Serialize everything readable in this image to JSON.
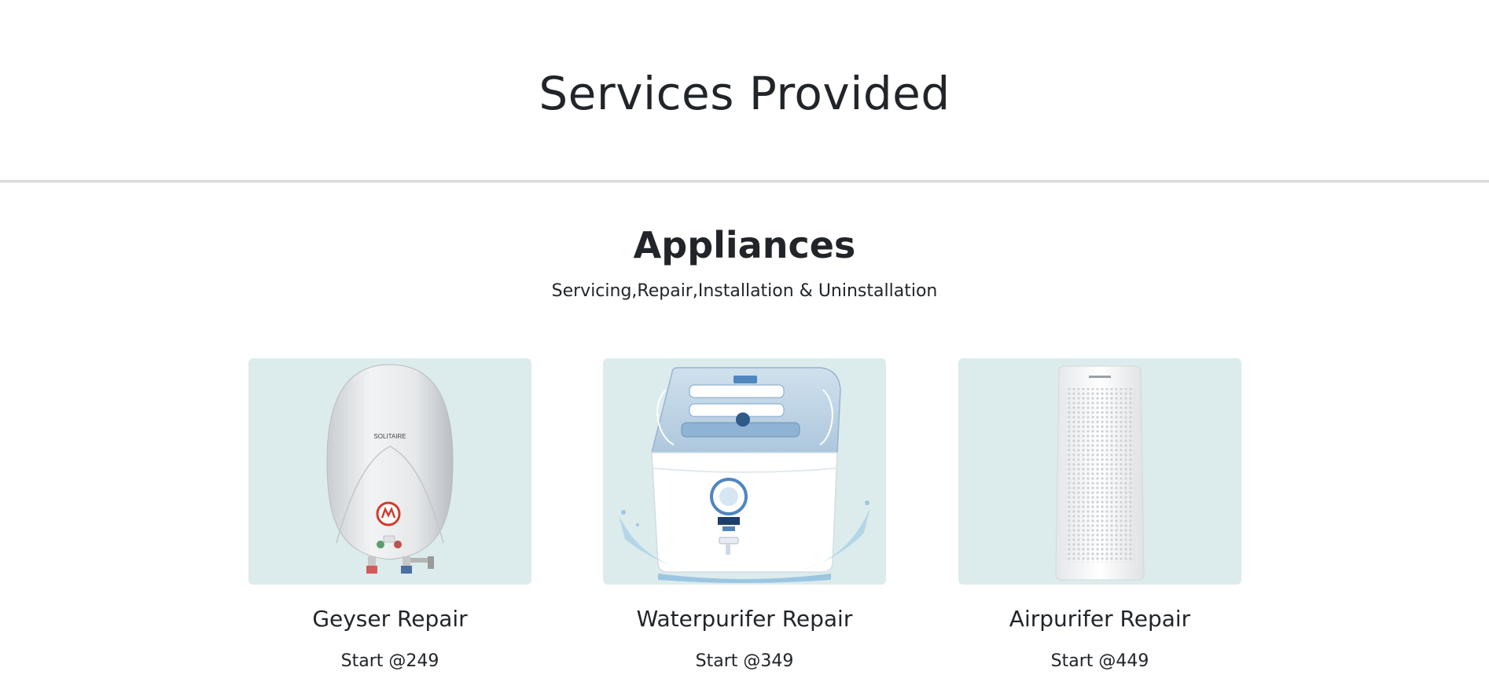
{
  "header": {
    "title": "Services Provided"
  },
  "section": {
    "title": "Appliances",
    "subtitle": "Servicing,Repair,Installation & Uninstallation"
  },
  "cards": [
    {
      "title": "Geyser Repair",
      "price": "Start @249",
      "image": "geyser-image",
      "image_label": "SOLITAIRE"
    },
    {
      "title": "Waterpurifer Repair",
      "price": "Start @349",
      "image": "water-purifier-image"
    },
    {
      "title": "Airpurifer Repair",
      "price": "Start @449",
      "image": "air-purifier-image"
    }
  ],
  "colors": {
    "card_background": "#dcebeb",
    "text": "#212529",
    "divider": "#dcdcdc"
  }
}
